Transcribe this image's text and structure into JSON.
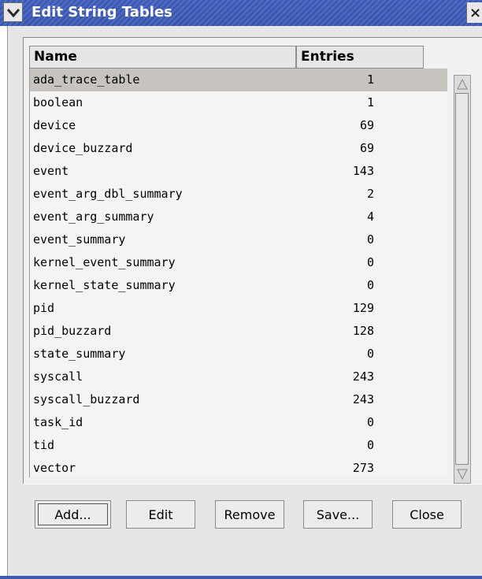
{
  "window": {
    "title": "Edit String Tables",
    "menu_icon": "chevron-down-icon",
    "close_label": "×"
  },
  "table": {
    "columns": [
      "Name",
      "Entries"
    ],
    "selected_row": 0,
    "rows": [
      {
        "name": "ada_trace_table",
        "entries": "1"
      },
      {
        "name": "boolean",
        "entries": "1"
      },
      {
        "name": "device",
        "entries": "69"
      },
      {
        "name": "device_buzzard",
        "entries": "69"
      },
      {
        "name": "event",
        "entries": "143"
      },
      {
        "name": "event_arg_dbl_summary",
        "entries": "2"
      },
      {
        "name": "event_arg_summary",
        "entries": "4"
      },
      {
        "name": "event_summary",
        "entries": "0"
      },
      {
        "name": "kernel_event_summary",
        "entries": "0"
      },
      {
        "name": "kernel_state_summary",
        "entries": "0"
      },
      {
        "name": "pid",
        "entries": "129"
      },
      {
        "name": "pid_buzzard",
        "entries": "128"
      },
      {
        "name": "state_summary",
        "entries": "0"
      },
      {
        "name": "syscall",
        "entries": "243"
      },
      {
        "name": "syscall_buzzard",
        "entries": "243"
      },
      {
        "name": "task_id",
        "entries": "0"
      },
      {
        "name": "tid",
        "entries": "0"
      },
      {
        "name": "vector",
        "entries": "273"
      }
    ]
  },
  "buttons": {
    "add": "Add...",
    "edit": "Edit",
    "remove": "Remove",
    "save": "Save...",
    "close": "Close"
  },
  "colors": {
    "titlebar": "#3c5ab6",
    "selection": "#c7c4bf"
  }
}
